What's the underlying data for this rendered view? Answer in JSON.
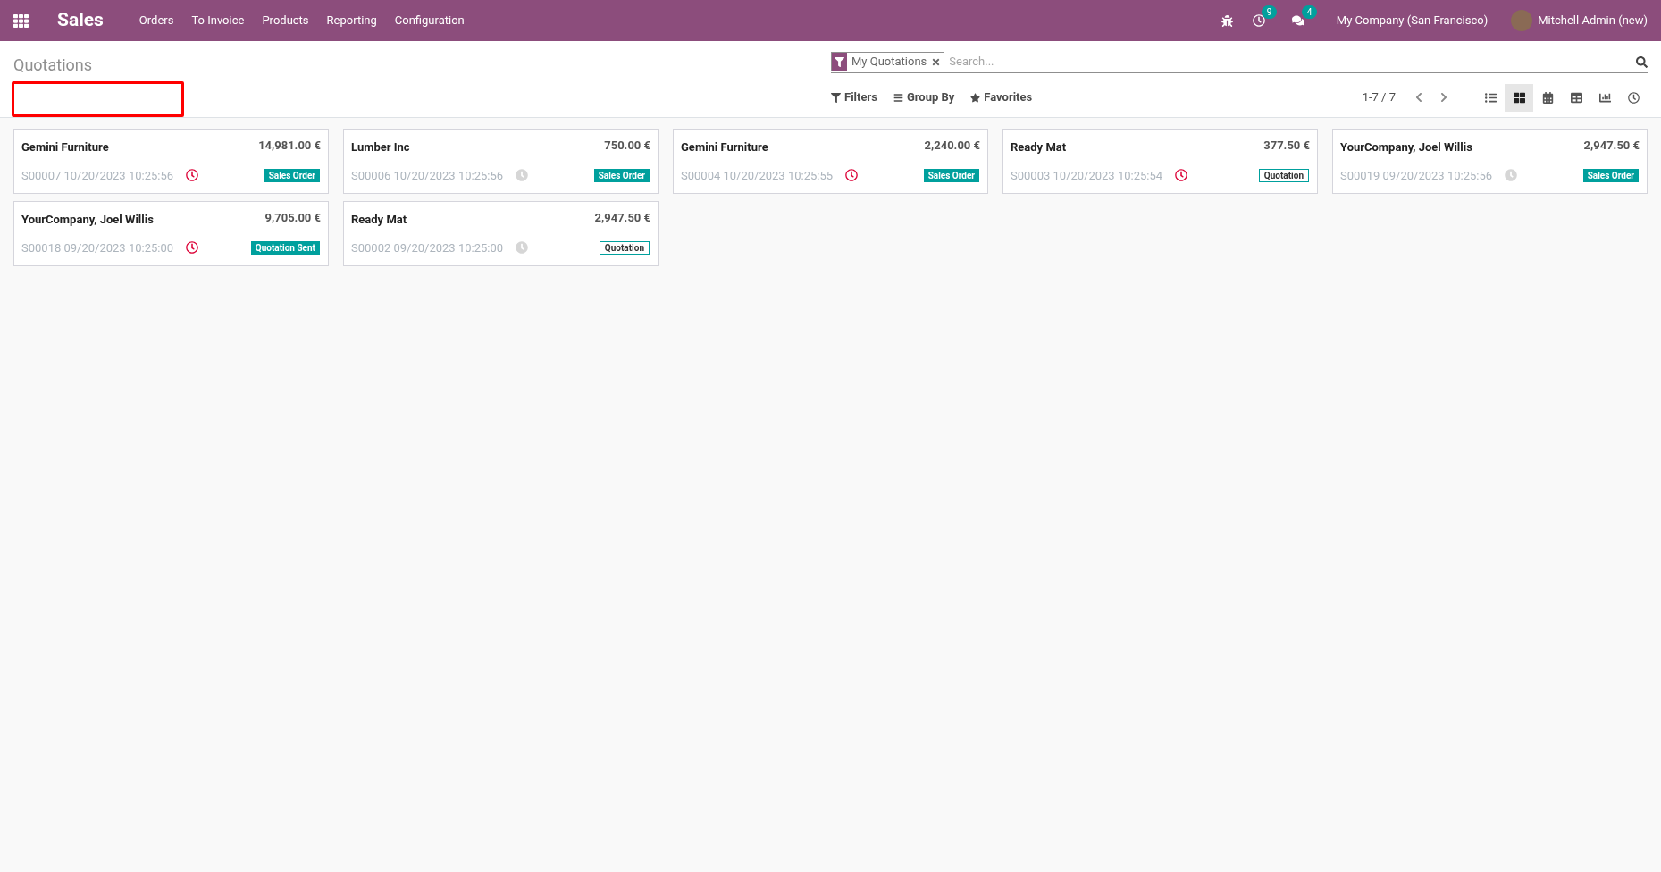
{
  "navbar": {
    "app_name": "Sales",
    "menu": [
      "Orders",
      "To Invoice",
      "Products",
      "Reporting",
      "Configuration"
    ],
    "activity_count": "9",
    "message_count": "4",
    "company": "My Company (San Francisco)",
    "user": "Mitchell Admin (new)"
  },
  "control_panel": {
    "title": "Quotations",
    "search": {
      "facet": "My Quotations",
      "placeholder": "Search..."
    },
    "filters": [
      "Filters",
      "Group By",
      "Favorites"
    ],
    "pager": "1-7 / 7",
    "views": [
      {
        "kind": "list",
        "selected": false
      },
      {
        "kind": "kanban",
        "selected": true
      },
      {
        "kind": "calendar",
        "selected": false
      },
      {
        "kind": "pivot",
        "selected": false
      },
      {
        "kind": "graph",
        "selected": false
      },
      {
        "kind": "activity",
        "selected": false
      }
    ]
  },
  "cards": [
    {
      "customer": "Gemini Furniture",
      "amount": "14,981.00 €",
      "reference": "S00007 10/20/2023 10:25:56",
      "overdue": true,
      "status": "Sales Order",
      "kind": "filled"
    },
    {
      "customer": "Lumber Inc",
      "amount": "750.00 €",
      "reference": "S00006 10/20/2023 10:25:56",
      "overdue": false,
      "status": "Sales Order",
      "kind": "filled"
    },
    {
      "customer": "Gemini Furniture",
      "amount": "2,240.00 €",
      "reference": "S00004 10/20/2023 10:25:55",
      "overdue": true,
      "status": "Sales Order",
      "kind": "filled"
    },
    {
      "customer": "Ready Mat",
      "amount": "377.50 €",
      "reference": "S00003 10/20/2023 10:25:54",
      "overdue": true,
      "status": "Quotation",
      "kind": "outlined"
    },
    {
      "customer": "YourCompany, Joel Willis",
      "amount": "2,947.50 €",
      "reference": "S00019 09/20/2023 10:25:56",
      "overdue": false,
      "status": "Sales Order",
      "kind": "filled"
    },
    {
      "customer": "YourCompany, Joel Willis",
      "amount": "9,705.00 €",
      "reference": "S00018 09/20/2023 10:25:00",
      "overdue": true,
      "status": "Quotation Sent",
      "kind": "filled"
    },
    {
      "customer": "Ready Mat",
      "amount": "2,947.50 €",
      "reference": "S00002 09/20/2023 10:25:00",
      "overdue": false,
      "status": "Quotation",
      "kind": "outlined"
    }
  ]
}
